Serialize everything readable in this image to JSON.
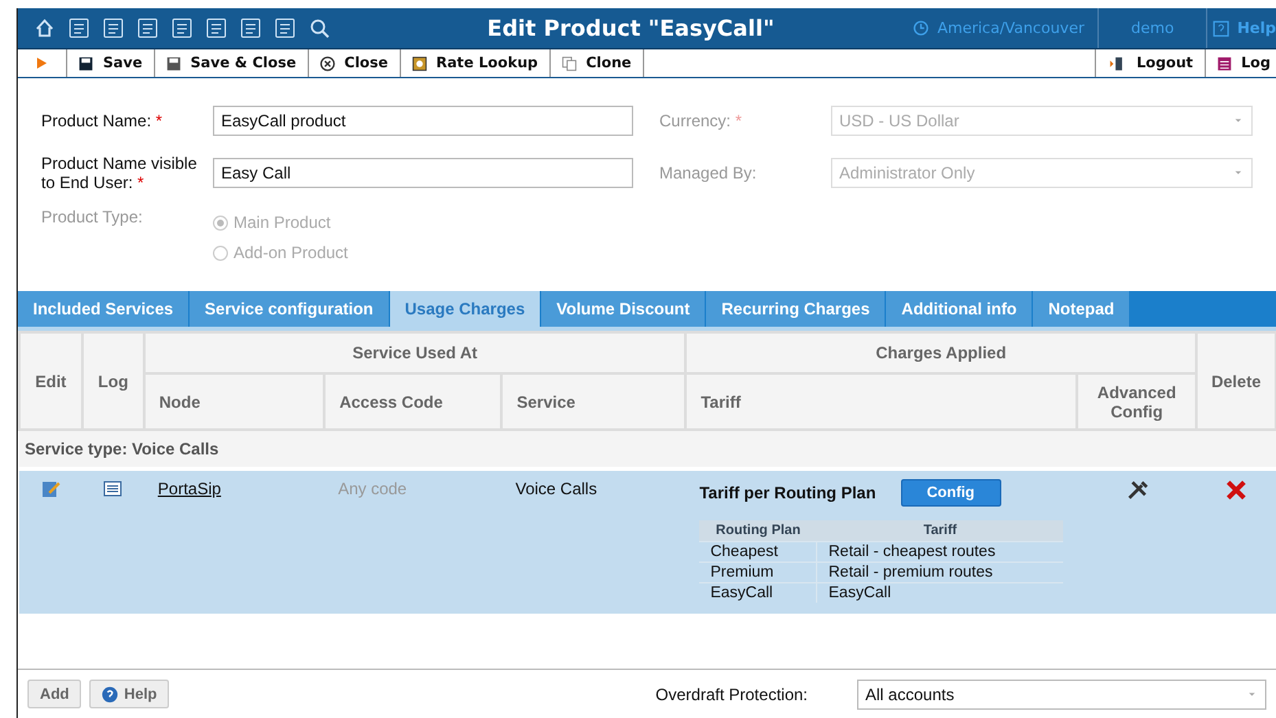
{
  "header": {
    "title": "Edit Product \"EasyCall\"",
    "timezone": "America/Vancouver",
    "user": "demo",
    "help": "Help"
  },
  "toolbar": {
    "left": [
      {
        "label": "Save",
        "kind": "save"
      },
      {
        "label": "Save & Close",
        "kind": "save-close"
      },
      {
        "label": "Close",
        "kind": "close"
      },
      {
        "label": "Rate Lookup",
        "kind": "rate"
      },
      {
        "label": "Clone",
        "kind": "clone"
      }
    ],
    "right": [
      {
        "label": "Logout",
        "kind": "logout"
      },
      {
        "label": "Log",
        "kind": "log"
      }
    ]
  },
  "form": {
    "left": [
      {
        "label": "Product Name:",
        "required_mark": "*",
        "value": "EasyCall product"
      },
      {
        "label": "Product Name visible to End User:",
        "required_mark": "*",
        "value": "Easy Call"
      }
    ],
    "right": [
      {
        "label": "Currency:",
        "required_mark": "*",
        "value": "USD - US Dollar",
        "disabled": true
      },
      {
        "label": "Managed By:",
        "value": "Administrator Only",
        "disabled": true
      }
    ],
    "product_type": {
      "label": "Product Type:",
      "disabled": true,
      "options": [
        {
          "label": "Main Product",
          "selected": true
        },
        {
          "label": "Add-on Product",
          "selected": false
        }
      ]
    }
  },
  "tabs": [
    {
      "label": "Included Services",
      "selected": false
    },
    {
      "label": "Service configuration",
      "selected": false
    },
    {
      "label": "Usage Charges",
      "selected": true
    },
    {
      "label": "Volume Discount",
      "selected": false
    },
    {
      "label": "Recurring Charges",
      "selected": false
    },
    {
      "label": "Additional info",
      "selected": false
    },
    {
      "label": "Notepad",
      "selected": false
    }
  ],
  "table": {
    "edit_header": "Edit",
    "log_header": "Log",
    "used_at_header": "Service Used At",
    "charges_header": "Charges Applied",
    "delete_header": "Delete",
    "columns": [
      "Node",
      "Access Code",
      "Service",
      "Tariff",
      "Advanced Config"
    ],
    "section": "Service type: Voice Calls",
    "rows": [
      {
        "node": "PortaSip",
        "access_code": "Any code",
        "service": "Voice Calls",
        "tariff": "Tariff per Routing Plan",
        "config_button": "Config",
        "plans": {
          "columns": [
            "Routing Plan",
            "Tariff"
          ],
          "rows": [
            [
              "Cheapest",
              "Retail - cheapest routes"
            ],
            [
              "Premium",
              "Retail - premium routes"
            ],
            [
              "EasyCall",
              "EasyCall"
            ]
          ]
        }
      }
    ]
  },
  "footer": {
    "buttons": [
      {
        "label": "Add",
        "kind": "plain"
      },
      {
        "label": "Help",
        "kind": "help"
      }
    ],
    "overdraft_label": "Overdraft Protection:",
    "overdraft_value": "All accounts"
  }
}
